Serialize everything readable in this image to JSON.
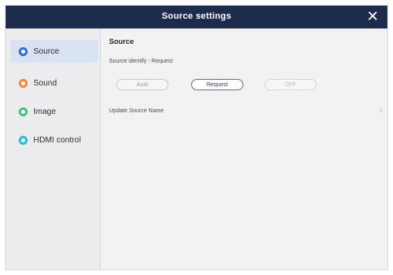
{
  "window": {
    "title": "Source settings",
    "close_glyph": "✕"
  },
  "sidebar": {
    "items": [
      {
        "label": "Source",
        "color": "#2f6fd6",
        "active": true
      },
      {
        "label": "Sound",
        "color": "#f0873d",
        "active": false
      },
      {
        "label": "Image",
        "color": "#45c27a",
        "active": false
      },
      {
        "label": "HDMI control",
        "color": "#2fb8d6",
        "active": false
      }
    ]
  },
  "main": {
    "section_title": "Source",
    "identify_text": "Source identify : Request",
    "options": [
      "Auto",
      "Request",
      "OFF"
    ],
    "selected_option": "Request",
    "update_label": "Update Source Name",
    "chevron_glyph": "›"
  }
}
